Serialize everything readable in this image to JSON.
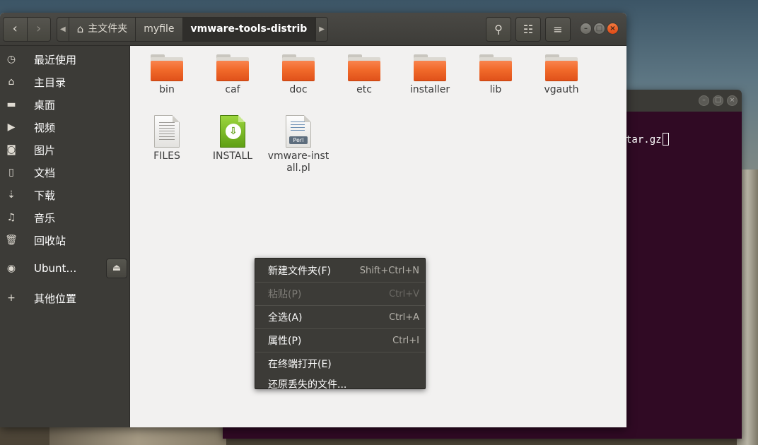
{
  "file_manager": {
    "back_icon": "chevron-left-icon",
    "forward_icon": "chevron-right-icon",
    "breadcrumbs": [
      "主文件夹",
      "myfile",
      "vmware-tools-distrib"
    ],
    "toolbar_icons": [
      "search-icon",
      "view-toggle-icon",
      "hamburger-menu-icon"
    ],
    "window_controls": [
      "minimize",
      "maximize",
      "close"
    ]
  },
  "sidebar": {
    "items": [
      {
        "label": "最近使用",
        "icon": "clock-icon"
      },
      {
        "label": "主目录",
        "icon": "home-icon"
      },
      {
        "label": "桌面",
        "icon": "desktop-folder-icon"
      },
      {
        "label": "视频",
        "icon": "video-icon"
      },
      {
        "label": "图片",
        "icon": "camera-icon"
      },
      {
        "label": "文档",
        "icon": "document-icon"
      },
      {
        "label": "下载",
        "icon": "download-icon"
      },
      {
        "label": "音乐",
        "icon": "music-icon"
      },
      {
        "label": "回收站",
        "icon": "trash-icon"
      },
      {
        "label": "Ubunt…",
        "icon": "disc-icon",
        "ejectable": true
      },
      {
        "label": "其他位置",
        "icon": "plus-icon"
      }
    ]
  },
  "files": [
    {
      "name": "bin",
      "type": "folder"
    },
    {
      "name": "caf",
      "type": "folder"
    },
    {
      "name": "doc",
      "type": "folder"
    },
    {
      "name": "etc",
      "type": "folder"
    },
    {
      "name": "installer",
      "type": "folder"
    },
    {
      "name": "lib",
      "type": "folder"
    },
    {
      "name": "vgauth",
      "type": "folder"
    },
    {
      "name": "FILES",
      "type": "text"
    },
    {
      "name": "INSTALL",
      "type": "install"
    },
    {
      "name": "vmware-install.pl",
      "type": "perl",
      "badge": "Perl"
    }
  ],
  "context_menu": {
    "items": [
      {
        "label": "新建文件夹(F)",
        "accel": "Shift+Ctrl+N",
        "enabled": true
      },
      {
        "label": "粘贴(P)",
        "accel": "Ctrl+V",
        "enabled": false
      },
      {
        "label": "全选(A)",
        "accel": "Ctrl+A",
        "enabled": true
      },
      {
        "label": "属性(P)",
        "accel": "Ctrl+I",
        "enabled": true
      },
      {
        "label": "在终端打开(E)",
        "accel": "",
        "enabled": true
      },
      {
        "label": "还原丢失的文件...",
        "accel": "",
        "enabled": true
      }
    ]
  },
  "terminal": {
    "visible_text": "tar.gz"
  }
}
